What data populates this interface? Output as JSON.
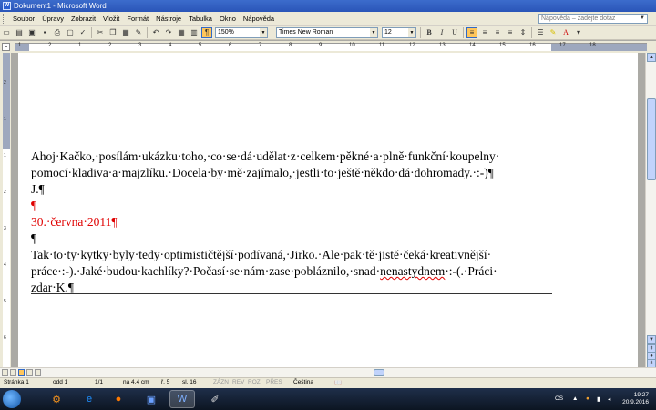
{
  "window": {
    "title": "Dokument1 - Microsoft Word",
    "app_icon": "W"
  },
  "menu": {
    "items": [
      {
        "label": "Soubor"
      },
      {
        "label": "Úpravy"
      },
      {
        "label": "Zobrazit"
      },
      {
        "label": "Vložit"
      },
      {
        "label": "Formát"
      },
      {
        "label": "Nástroje"
      },
      {
        "label": "Tabulka"
      },
      {
        "label": "Okno"
      },
      {
        "label": "Nápověda"
      }
    ],
    "help_placeholder": "Nápověda – zadejte dotaz"
  },
  "toolbar": {
    "zoom": "150%",
    "pilcrow": "¶",
    "font_name": "Times New Roman",
    "font_size": "12",
    "bold": "B",
    "italic": "I",
    "underline": "U",
    "font_color_letter": "A"
  },
  "ruler": {
    "marks": [
      "1",
      "2",
      "1",
      "2",
      "3",
      "4",
      "5",
      "6",
      "7",
      "8",
      "9",
      "10",
      "11",
      "12",
      "13",
      "14",
      "15",
      "16",
      "17",
      "18"
    ],
    "vmarks": [
      "2",
      "1",
      "1",
      "2",
      "3",
      "4",
      "5",
      "6"
    ]
  },
  "document": {
    "lines": [
      {
        "text": "Ahoj·Kačko,·posílám·ukázku·toho,·co·se·dá·udělat·z·celkem·pěkné·a·plně·funkční·koupelny·",
        "color": "#000000"
      },
      {
        "text": "pomocí·kladiva·a·majzlíku.·Docela·by·mě·zajímalo,·jestli·to·ještě·někdo·dá·dohromady.·:-)¶",
        "color": "#000000"
      },
      {
        "text": "J.¶",
        "color": "#000000"
      },
      {
        "text": "¶",
        "color": "#e00000"
      },
      {
        "text": "30.·června·2011¶",
        "color": "#e00000"
      },
      {
        "text": "¶",
        "color": "#000000"
      },
      {
        "text": "Tak·to·ty·kytky·byly·tedy·optimističtější·podívaná,·Jirko.·Ale·pak·tě·jistě·čeká·kreativnější·",
        "color": "#000000"
      },
      {
        "text_before": "práce·:-).·Jaké·budou·kachlíky?·Počasí·se·nám·zase·pobláznilo,·snad·",
        "misspelled": "nenastydnem",
        "text_after": "·:-(.·Práci·",
        "color": "#000000"
      },
      {
        "text": "zdar·K.¶",
        "color": "#000000"
      }
    ]
  },
  "status": {
    "page": "Stránka 1",
    "section": "odd 1",
    "pages": "1/1",
    "position": "na 4,4 cm",
    "line": "ř. 5",
    "column": "sl. 16",
    "rec": "ZÁZN",
    "trk": "REV",
    "ext": "ROZ",
    "ovr": "PŘES",
    "language": "Čeština"
  },
  "taskbar": {
    "lang": "CS",
    "time": "19:27",
    "date": "20.9.2016"
  },
  "colors": {
    "title_bar": "#2a55b8",
    "revision_red": "#e00000",
    "chrome": "#ece9d8"
  }
}
